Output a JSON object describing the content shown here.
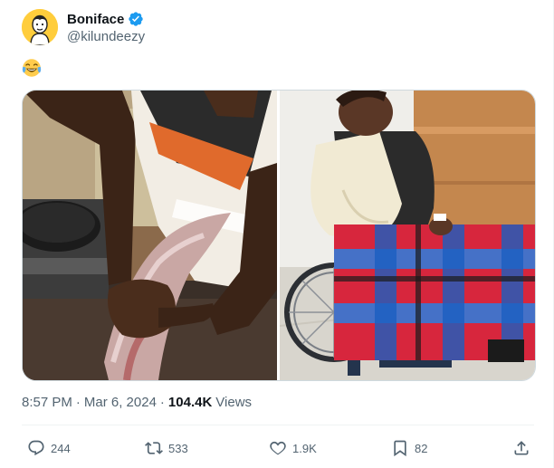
{
  "author": {
    "name": "Boniface",
    "handle": "@kilundeezy",
    "verified": true,
    "verified_color": "#1d9bf0"
  },
  "tweet": {
    "emoji_icon": "face-with-tears-of-joy-icon"
  },
  "media": {
    "count": 2
  },
  "meta": {
    "time": "8:57 PM",
    "separator": "·",
    "date": "Mar 6, 2024",
    "separator2": "·",
    "views_count": "104.4K",
    "views_label": "Views"
  },
  "actions": {
    "replies": "244",
    "retweets": "533",
    "likes": "1.9K",
    "bookmarks": "82"
  },
  "colors": {
    "text": "#0f1419",
    "secondary": "#536471",
    "accent": "#1d9bf0"
  }
}
